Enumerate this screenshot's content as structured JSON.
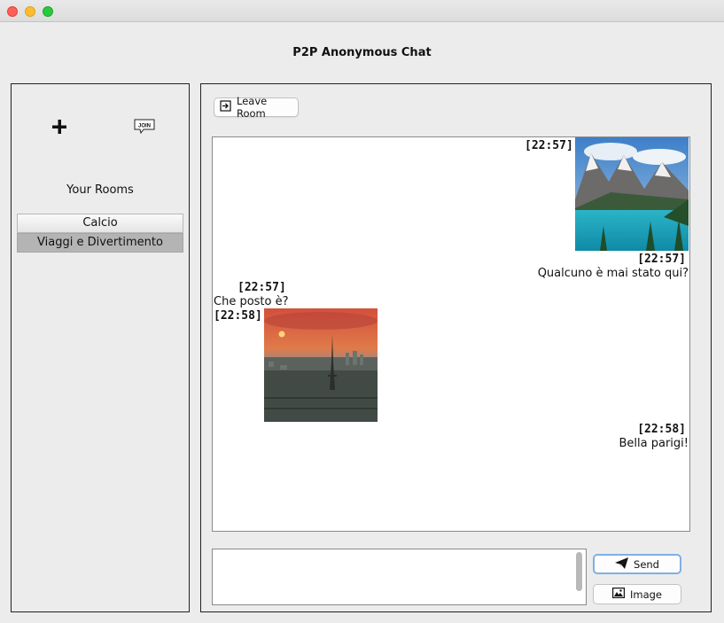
{
  "window": {
    "title": "P2P Anonymous Chat"
  },
  "sidebar": {
    "add_icon": "plus-icon",
    "join_icon": "join-bubble-icon",
    "join_icon_text": "JOIN",
    "rooms_label": "Your Rooms",
    "rooms": [
      {
        "label": "Calcio",
        "selected": false
      },
      {
        "label": "Viaggi e Divertimento",
        "selected": true
      }
    ]
  },
  "chat": {
    "leave_button": {
      "label": "Leave Room",
      "icon": "exit-icon"
    },
    "messages": [
      {
        "side": "right",
        "time": "[22:57]",
        "type": "image",
        "image": "mountain-lake-photo"
      },
      {
        "side": "right",
        "time": "[22:57]",
        "type": "text",
        "text": "Qualcuno è mai stato qui?"
      },
      {
        "side": "left",
        "time": "[22:57]",
        "type": "text",
        "text": "Che posto è?"
      },
      {
        "side": "left",
        "time": "[22:58]",
        "type": "image",
        "image": "paris-sunset-photo"
      },
      {
        "side": "right",
        "time": "[22:58]",
        "type": "text",
        "text": "Bella parigi!"
      }
    ]
  },
  "composer": {
    "value": "",
    "send_button": {
      "label": "Send",
      "icon": "paper-plane-icon"
    },
    "image_button": {
      "label": "Image",
      "icon": "picture-icon"
    }
  },
  "colors": {
    "close": "#fe5f57",
    "minimize": "#febc2e",
    "maximize": "#28c840",
    "selected_room": "#b4b4b4",
    "send_focus": "#7fb0e6"
  }
}
